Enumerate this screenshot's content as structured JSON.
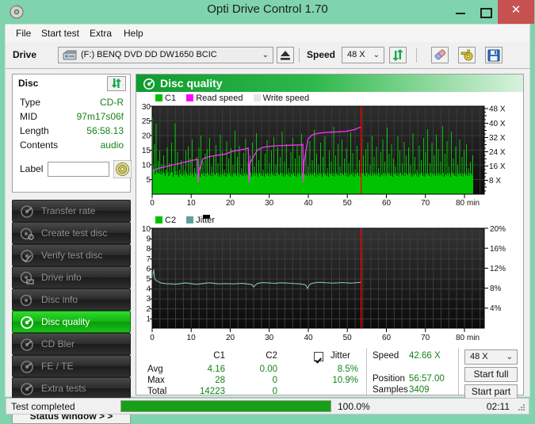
{
  "window": {
    "title": "Opti Drive Control 1.70",
    "app_icon": "disc-icon",
    "minimize": "–",
    "maximize": "□",
    "close": "✕",
    "close_color": "#c75050",
    "frame_color": "#7fd4ae"
  },
  "menu": [
    {
      "label": "File"
    },
    {
      "label": "Start test"
    },
    {
      "label": "Extra"
    },
    {
      "label": "Help"
    }
  ],
  "toolbar": {
    "drive_label": "Drive",
    "drive_value": "(F:)   BENQ DVD DD DW1650 BCIC",
    "eject_icon": "eject-icon",
    "speed_label": "Speed",
    "speed_value": "48 X",
    "refresh_icon": "refresh-icon",
    "eraser_icon": "eraser-icon",
    "settings_icon": "gear-icon",
    "save_icon": "save-icon"
  },
  "disc_panel": {
    "title": "Disc",
    "refresh_icon": "refresh-icon",
    "rows": [
      {
        "key": "Type",
        "value": "CD-R"
      },
      {
        "key": "MID",
        "value": "97m17s06f"
      },
      {
        "key": "Length",
        "value": "56:58.13"
      },
      {
        "key": "Contents",
        "value": "audio"
      }
    ],
    "label_key": "Label",
    "label_value": "",
    "label_placeholder": "",
    "label_button_icon": "cd-icon"
  },
  "sidebar": {
    "items": [
      {
        "label": "Transfer rate",
        "icon": "disc-test-icon",
        "active": false
      },
      {
        "label": "Create test disc",
        "icon": "disc-create-icon",
        "active": false
      },
      {
        "label": "Verify test disc",
        "icon": "disc-verify-icon",
        "active": false
      },
      {
        "label": "Drive info",
        "icon": "drive-info-icon",
        "active": false
      },
      {
        "label": "Disc info",
        "icon": "disc-info-icon",
        "active": false
      },
      {
        "label": "Disc quality",
        "icon": "disc-quality-icon",
        "active": true
      },
      {
        "label": "CD Bler",
        "icon": "cd-bler-icon",
        "active": false
      },
      {
        "label": "FE / TE",
        "icon": "fe-te-icon",
        "active": false
      },
      {
        "label": "Extra tests",
        "icon": "extra-tests-icon",
        "active": false
      }
    ],
    "status_window_button": "Status window > >"
  },
  "main": {
    "header_title": "Disc quality",
    "header_icon": "disc-quality-icon"
  },
  "stats": {
    "col_headers": [
      "C1",
      "C2"
    ],
    "row_headers": [
      "Avg",
      "Max",
      "Total"
    ],
    "c1": [
      "4.16",
      "28",
      "14223"
    ],
    "c2": [
      "0.00",
      "0",
      "0"
    ],
    "jitter_label": "Jitter",
    "jitter_checked": true,
    "jitter_avg": "8.5%",
    "jitter_max": "10.9%",
    "speed_label": "Speed",
    "speed_value": "42.66 X",
    "position_label": "Position",
    "position_value": "56:57.00",
    "samples_label": "Samples",
    "samples_value": "3409",
    "speed_select": "48 X",
    "start_full": "Start full",
    "start_part": "Start part"
  },
  "statusbar": {
    "message": "Test completed",
    "progress_percent": 100.0,
    "percent_text": "100.0%",
    "elapsed": "02:11",
    "progress_color": "#16a016"
  },
  "chart_data": [
    {
      "type": "line",
      "name": "C1 / Read speed chart",
      "title": "",
      "xlabel": "min",
      "ylabel": "",
      "xlim": [
        0,
        84
      ],
      "ylim": [
        0,
        30
      ],
      "y2lim": [
        0,
        48
      ],
      "grid": true,
      "legend": [
        "C1",
        "Read speed",
        "Write speed"
      ],
      "legend_colors": [
        "#00c000",
        "#ff00ff",
        "#e6e6e6"
      ],
      "xticks": [
        0,
        10,
        20,
        30,
        40,
        50,
        60,
        70,
        80
      ],
      "yticks": [
        5,
        10,
        15,
        20,
        25,
        30
      ],
      "y2ticks": [
        "8 X",
        "16 X",
        "24 X",
        "32 X",
        "40 X",
        "48 X"
      ],
      "data_end_min": 56.95,
      "marker_line_min": 56.95,
      "marker_color": "#ff0000",
      "series": [
        {
          "name": "Read speed",
          "color": "#ff00ff",
          "x": [
            0,
            1,
            2,
            3,
            4,
            5,
            6,
            7,
            8,
            9,
            10,
            11,
            11.7,
            11.8,
            12,
            13,
            14,
            15,
            16,
            17,
            18,
            19,
            20,
            21,
            22,
            23,
            24,
            24.6,
            24.8,
            25,
            26,
            27,
            28,
            29,
            30,
            32,
            34,
            36,
            38,
            40,
            40.6,
            40.8,
            41,
            42,
            43,
            44,
            45,
            46,
            48,
            50,
            52,
            54,
            55,
            56,
            56.9
          ],
          "y2": [
            13.0,
            13.4,
            13.8,
            14.1,
            14.4,
            14.7,
            15.0,
            15.3,
            15.6,
            15.9,
            16.2,
            16.5,
            16.6,
            4.0,
            8.2,
            16.9,
            17.4,
            17.8,
            18.0,
            18.2,
            18.4,
            18.6,
            19.2,
            19.6,
            19.8,
            20.0,
            20.3,
            20.6,
            4.0,
            10.5,
            18.4,
            20.8,
            21.5,
            21.8,
            22.0,
            22.2,
            22.3,
            22.4,
            22.5,
            22.6,
            22.8,
            4.0,
            11.0,
            19.5,
            20.8,
            21.2,
            21.5,
            21.6,
            21.8,
            21.9,
            22.1,
            22.6,
            23.2,
            23.6,
            23.7
          ]
        },
        {
          "name": "C1",
          "color": "#00c000",
          "description": "Dense green error-count spikes, baseline ~4-10, peaks to 26",
          "baseline": 6,
          "peak_max": 26
        }
      ]
    },
    {
      "type": "line",
      "name": "C2 / Jitter chart",
      "title": "",
      "xlabel": "min",
      "ylabel": "",
      "xlim": [
        0,
        84
      ],
      "ylim": [
        0,
        10
      ],
      "y2lim": [
        0,
        20
      ],
      "grid": true,
      "legend": [
        "C2",
        "Jitter"
      ],
      "legend_colors": [
        "#00c000",
        "#5f9ea0"
      ],
      "xticks": [
        0,
        10,
        20,
        30,
        40,
        50,
        60,
        70,
        80
      ],
      "yticks": [
        1,
        2,
        3,
        4,
        5,
        6,
        7,
        8,
        9,
        10
      ],
      "y2ticks": [
        "4%",
        "8%",
        "12%",
        "16%",
        "20%"
      ],
      "data_end_min": 56.95,
      "marker_line_min": 56.95,
      "marker_color": "#ff0000",
      "series": [
        {
          "name": "Jitter",
          "color": "#6fa8a8",
          "x": [
            0,
            0.4,
            0.8,
            1.5,
            2.5,
            3.5,
            5,
            7,
            9,
            11,
            13,
            15,
            17,
            19,
            21,
            23,
            24.5,
            25.5,
            26.5,
            28,
            30,
            32,
            34,
            36,
            38,
            40,
            41,
            42,
            43,
            45,
            47,
            49,
            50.5,
            52,
            54,
            55,
            56,
            56.9
          ],
          "y": [
            5.0,
            5.4,
            4.9,
            4.7,
            4.6,
            4.5,
            4.45,
            4.4,
            4.3,
            4.28,
            4.25,
            4.3,
            4.35,
            4.3,
            4.25,
            4.2,
            4.0,
            4.25,
            4.4,
            4.5,
            4.45,
            4.4,
            4.38,
            4.35,
            4.3,
            4.15,
            3.7,
            4.2,
            4.4,
            4.45,
            4.5,
            4.55,
            4.5,
            4.45,
            4.4,
            4.42,
            4.45,
            4.45
          ]
        },
        {
          "name": "C2",
          "color": "#00c000",
          "description": "No C2 errors recorded (flat zero)",
          "values": []
        }
      ]
    }
  ]
}
